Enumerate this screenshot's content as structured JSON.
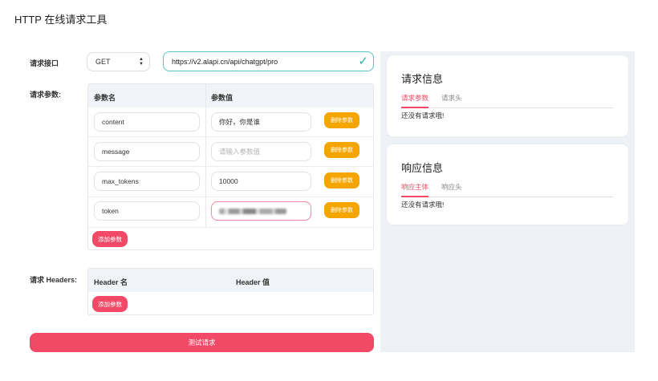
{
  "app": {
    "title": "HTTP 在线请求工具"
  },
  "request": {
    "endpoint_label": "请求接口",
    "method": "GET",
    "url": "https://v2.alapi.cn/api/chatgpt/pro",
    "params_label": "请求参数:",
    "headers_label": "请求 Headers:"
  },
  "params_table": {
    "col_name": "参数名",
    "col_value": "参数值",
    "rows": [
      {
        "name": "content",
        "value": "你好，你是谁",
        "value_placeholder": "",
        "delete_label": "删除参数"
      },
      {
        "name": "message",
        "value": "",
        "value_placeholder": "请输入参数值",
        "delete_label": "删除参数"
      },
      {
        "name": "max_tokens",
        "value": "10000",
        "value_placeholder": "",
        "delete_label": "删除参数"
      },
      {
        "name": "token",
        "value": "",
        "value_placeholder": "",
        "delete_label": "删除参数"
      }
    ],
    "add_label": "添加参数"
  },
  "headers_table": {
    "col_name": "Header 名",
    "col_value": "Header 值",
    "add_label": "添加参数"
  },
  "submit_label": "测试请求",
  "request_info": {
    "title": "请求信息",
    "tabs": [
      "请求参数",
      "请求头"
    ],
    "empty_text": "还没有请求哦!"
  },
  "response_info": {
    "title": "响应信息",
    "tabs": [
      "响应主体",
      "响应头"
    ],
    "empty_text": "还没有请求哦!"
  },
  "colors": {
    "accent_red": "#f24a66",
    "delete_orange": "#f5a500",
    "url_border": "#5bc4c4",
    "check_green": "#2bb3a7"
  },
  "icons": {
    "method_select": "updown-arrows-icon",
    "url_valid": "check-icon"
  }
}
